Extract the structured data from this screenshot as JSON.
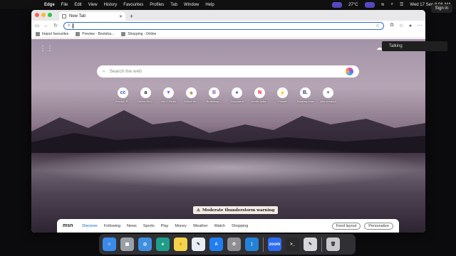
{
  "menubar": {
    "apple_icon": "apple-icon",
    "items": [
      "Edge",
      "File",
      "Edit",
      "View",
      "History",
      "Favourites",
      "Profiles",
      "Tab",
      "Window",
      "Help"
    ],
    "temperature": "27°C",
    "datetime": "Wed 17 Sep 8:06 AM"
  },
  "signin": {
    "label": "Sign in"
  },
  "browser": {
    "tab": {
      "title": "New Tab"
    },
    "bookmarks": [
      {
        "label": "Import favourites",
        "icon": "import-icon"
      },
      {
        "label": "Preview - Bootstra...",
        "icon": "page-icon"
      },
      {
        "label": "Shopping - Online",
        "icon": "shopping-icon"
      }
    ]
  },
  "ntp": {
    "search_placeholder": "Search the web",
    "talking": "Talking",
    "shortcuts": [
      {
        "label": "Proctor -B...",
        "glyph": "cc",
        "color": "#2b5fbf"
      },
      {
        "label": "Online Sho...",
        "glyph": "a",
        "color": "#111"
      },
      {
        "label": "Vite + React",
        "glyph": "▼",
        "color": "#8d58f2"
      },
      {
        "label": "Online Bo...",
        "glyph": "★",
        "color": "#b0922b"
      },
      {
        "label": "Bootstrap ...",
        "glyph": "B",
        "color": "#7952b3"
      },
      {
        "label": "Document",
        "glyph": "●",
        "color": "#2a5fd9"
      },
      {
        "label": "Netflix India...",
        "glyph": "N",
        "color": "#e50914"
      },
      {
        "label": "Fitchef",
        "glyph": "⚡",
        "color": "#f1a400"
      },
      {
        "label": "Booking.com",
        "glyph": "B.",
        "color": "#1e3a8a"
      },
      {
        "label": "Add shortcut",
        "glyph": "+",
        "color": "#555"
      }
    ],
    "warning": "Moderate thunderstorm warning",
    "msn": {
      "logo": "msn",
      "tabs": [
        "Discover",
        "Following",
        "News",
        "Sports",
        "Play",
        "Money",
        "Weather",
        "Watch",
        "Shopping"
      ],
      "feed_layout": "Feed layout",
      "personalize": "Personalize"
    }
  },
  "dock": {
    "apps": [
      {
        "name": "finder",
        "color": "#3a8be8",
        "glyph": "☺"
      },
      {
        "name": "launchpad",
        "color": "#9aa0a8",
        "glyph": "▦"
      },
      {
        "name": "safari",
        "color": "#3f8fe0",
        "glyph": "◎"
      },
      {
        "name": "edge",
        "color": "#1e9e8a",
        "glyph": "e"
      },
      {
        "name": "notes",
        "color": "#f5d34a",
        "glyph": "≡"
      },
      {
        "name": "freeform",
        "color": "#e9eef5",
        "glyph": "✎"
      },
      {
        "name": "app-store",
        "color": "#1f7ef0",
        "glyph": "A"
      },
      {
        "name": "system-settings",
        "color": "#8e8e93",
        "glyph": "⚙"
      },
      {
        "name": "vscode",
        "color": "#2382d6",
        "glyph": "⟩"
      },
      {
        "name": "zoom",
        "color": "#2d6cf0",
        "glyph": "zoom"
      },
      {
        "name": "terminal",
        "color": "#2a2a2a",
        "glyph": ">_"
      },
      {
        "name": "preview",
        "color": "#d8d8dc",
        "glyph": "✎"
      },
      {
        "name": "trash",
        "color": "#c8c8cc",
        "glyph": "🗑"
      }
    ]
  }
}
